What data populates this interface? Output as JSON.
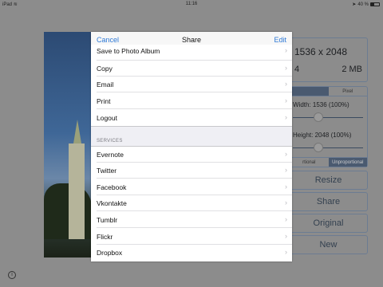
{
  "status_bar": {
    "device": "iPad",
    "wifi_icon": "wifi-icon",
    "time": "11:16",
    "location_icon": "location-icon",
    "battery": "40 %"
  },
  "background": {
    "info": {
      "dimensions": "1536 x 2048",
      "count": "4",
      "size": "2 MB"
    },
    "top_segments": [
      "",
      "Pixel"
    ],
    "width_label": "Width: 1536 (100%)",
    "height_label": "Height: 2048 (100%)",
    "bottom_segments": [
      "rtional",
      "Unproportional"
    ],
    "buttons": {
      "resize": "Resize",
      "share": "Share",
      "original": "Original",
      "new": "New"
    }
  },
  "sheet": {
    "header": {
      "cancel": "Cancel",
      "title": "Share",
      "edit": "Edit"
    },
    "actions": [
      {
        "label": "Save to Photo Album"
      },
      {
        "label": "Copy"
      },
      {
        "label": "Email"
      },
      {
        "label": "Print"
      },
      {
        "label": "Logout"
      }
    ],
    "services_title": "SERVICES",
    "services": [
      {
        "label": "Evernote"
      },
      {
        "label": "Twitter"
      },
      {
        "label": "Facebook"
      },
      {
        "label": "Vkontakte"
      },
      {
        "label": "Tumblr"
      },
      {
        "label": "Flickr"
      },
      {
        "label": "Dropbox"
      }
    ],
    "chevron": "›"
  },
  "info_icon": "i"
}
